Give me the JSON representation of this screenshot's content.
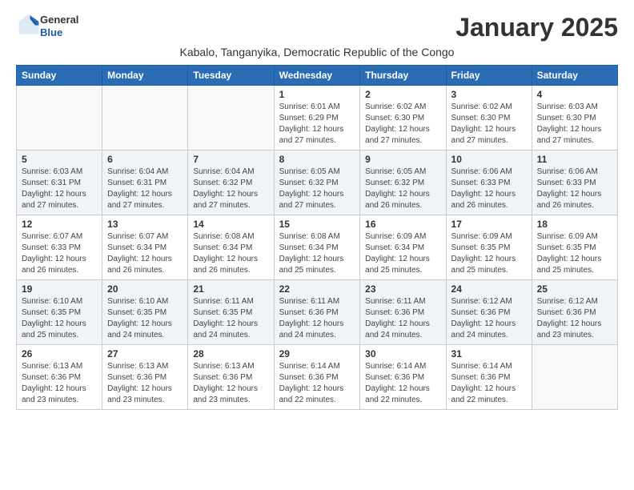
{
  "header": {
    "logo_general": "General",
    "logo_blue": "Blue",
    "month_title": "January 2025",
    "location": "Kabalo, Tanganyika, Democratic Republic of the Congo"
  },
  "days_of_week": [
    "Sunday",
    "Monday",
    "Tuesday",
    "Wednesday",
    "Thursday",
    "Friday",
    "Saturday"
  ],
  "weeks": [
    [
      {
        "day": "",
        "info": ""
      },
      {
        "day": "",
        "info": ""
      },
      {
        "day": "",
        "info": ""
      },
      {
        "day": "1",
        "info": "Sunrise: 6:01 AM\nSunset: 6:29 PM\nDaylight: 12 hours and 27 minutes."
      },
      {
        "day": "2",
        "info": "Sunrise: 6:02 AM\nSunset: 6:30 PM\nDaylight: 12 hours and 27 minutes."
      },
      {
        "day": "3",
        "info": "Sunrise: 6:02 AM\nSunset: 6:30 PM\nDaylight: 12 hours and 27 minutes."
      },
      {
        "day": "4",
        "info": "Sunrise: 6:03 AM\nSunset: 6:30 PM\nDaylight: 12 hours and 27 minutes."
      }
    ],
    [
      {
        "day": "5",
        "info": "Sunrise: 6:03 AM\nSunset: 6:31 PM\nDaylight: 12 hours and 27 minutes."
      },
      {
        "day": "6",
        "info": "Sunrise: 6:04 AM\nSunset: 6:31 PM\nDaylight: 12 hours and 27 minutes."
      },
      {
        "day": "7",
        "info": "Sunrise: 6:04 AM\nSunset: 6:32 PM\nDaylight: 12 hours and 27 minutes."
      },
      {
        "day": "8",
        "info": "Sunrise: 6:05 AM\nSunset: 6:32 PM\nDaylight: 12 hours and 27 minutes."
      },
      {
        "day": "9",
        "info": "Sunrise: 6:05 AM\nSunset: 6:32 PM\nDaylight: 12 hours and 26 minutes."
      },
      {
        "day": "10",
        "info": "Sunrise: 6:06 AM\nSunset: 6:33 PM\nDaylight: 12 hours and 26 minutes."
      },
      {
        "day": "11",
        "info": "Sunrise: 6:06 AM\nSunset: 6:33 PM\nDaylight: 12 hours and 26 minutes."
      }
    ],
    [
      {
        "day": "12",
        "info": "Sunrise: 6:07 AM\nSunset: 6:33 PM\nDaylight: 12 hours and 26 minutes."
      },
      {
        "day": "13",
        "info": "Sunrise: 6:07 AM\nSunset: 6:34 PM\nDaylight: 12 hours and 26 minutes."
      },
      {
        "day": "14",
        "info": "Sunrise: 6:08 AM\nSunset: 6:34 PM\nDaylight: 12 hours and 26 minutes."
      },
      {
        "day": "15",
        "info": "Sunrise: 6:08 AM\nSunset: 6:34 PM\nDaylight: 12 hours and 25 minutes."
      },
      {
        "day": "16",
        "info": "Sunrise: 6:09 AM\nSunset: 6:34 PM\nDaylight: 12 hours and 25 minutes."
      },
      {
        "day": "17",
        "info": "Sunrise: 6:09 AM\nSunset: 6:35 PM\nDaylight: 12 hours and 25 minutes."
      },
      {
        "day": "18",
        "info": "Sunrise: 6:09 AM\nSunset: 6:35 PM\nDaylight: 12 hours and 25 minutes."
      }
    ],
    [
      {
        "day": "19",
        "info": "Sunrise: 6:10 AM\nSunset: 6:35 PM\nDaylight: 12 hours and 25 minutes."
      },
      {
        "day": "20",
        "info": "Sunrise: 6:10 AM\nSunset: 6:35 PM\nDaylight: 12 hours and 24 minutes."
      },
      {
        "day": "21",
        "info": "Sunrise: 6:11 AM\nSunset: 6:35 PM\nDaylight: 12 hours and 24 minutes."
      },
      {
        "day": "22",
        "info": "Sunrise: 6:11 AM\nSunset: 6:36 PM\nDaylight: 12 hours and 24 minutes."
      },
      {
        "day": "23",
        "info": "Sunrise: 6:11 AM\nSunset: 6:36 PM\nDaylight: 12 hours and 24 minutes."
      },
      {
        "day": "24",
        "info": "Sunrise: 6:12 AM\nSunset: 6:36 PM\nDaylight: 12 hours and 24 minutes."
      },
      {
        "day": "25",
        "info": "Sunrise: 6:12 AM\nSunset: 6:36 PM\nDaylight: 12 hours and 23 minutes."
      }
    ],
    [
      {
        "day": "26",
        "info": "Sunrise: 6:13 AM\nSunset: 6:36 PM\nDaylight: 12 hours and 23 minutes."
      },
      {
        "day": "27",
        "info": "Sunrise: 6:13 AM\nSunset: 6:36 PM\nDaylight: 12 hours and 23 minutes."
      },
      {
        "day": "28",
        "info": "Sunrise: 6:13 AM\nSunset: 6:36 PM\nDaylight: 12 hours and 23 minutes."
      },
      {
        "day": "29",
        "info": "Sunrise: 6:14 AM\nSunset: 6:36 PM\nDaylight: 12 hours and 22 minutes."
      },
      {
        "day": "30",
        "info": "Sunrise: 6:14 AM\nSunset: 6:36 PM\nDaylight: 12 hours and 22 minutes."
      },
      {
        "day": "31",
        "info": "Sunrise: 6:14 AM\nSunset: 6:36 PM\nDaylight: 12 hours and 22 minutes."
      },
      {
        "day": "",
        "info": ""
      }
    ]
  ]
}
